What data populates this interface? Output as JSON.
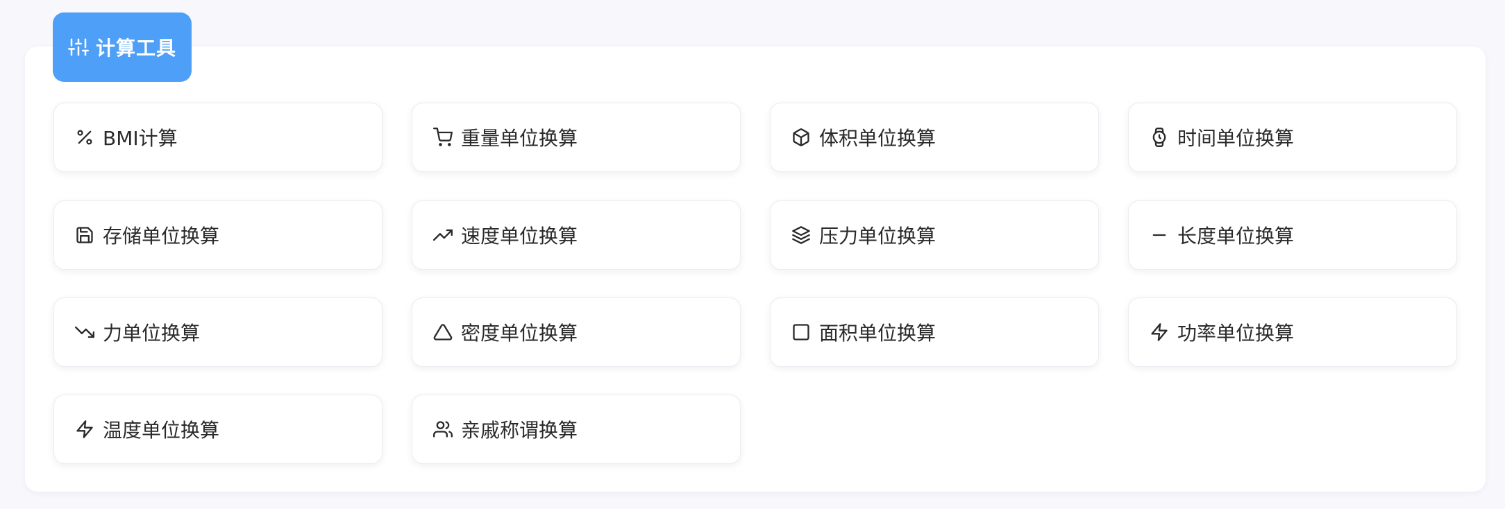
{
  "header": {
    "title": "计算工具",
    "icon": "sliders-icon",
    "accent_color": "#4e9ff8"
  },
  "tools": [
    {
      "label": "BMI计算",
      "icon": "percent-icon"
    },
    {
      "label": "重量单位换算",
      "icon": "cart-icon"
    },
    {
      "label": "体积单位换算",
      "icon": "cube-icon"
    },
    {
      "label": "时间单位换算",
      "icon": "watch-icon"
    },
    {
      "label": "存储单位换算",
      "icon": "save-icon"
    },
    {
      "label": "速度单位换算",
      "icon": "trending-up-icon"
    },
    {
      "label": "压力单位换算",
      "icon": "layers-icon"
    },
    {
      "label": "长度单位换算",
      "icon": "minus-icon"
    },
    {
      "label": "力单位换算",
      "icon": "trending-down-icon"
    },
    {
      "label": "密度单位换算",
      "icon": "triangle-icon"
    },
    {
      "label": "面积单位换算",
      "icon": "square-icon"
    },
    {
      "label": "功率单位换算",
      "icon": "zap-icon"
    },
    {
      "label": "温度单位换算",
      "icon": "zap-icon"
    },
    {
      "label": "亲戚称谓换算",
      "icon": "users-icon"
    }
  ]
}
